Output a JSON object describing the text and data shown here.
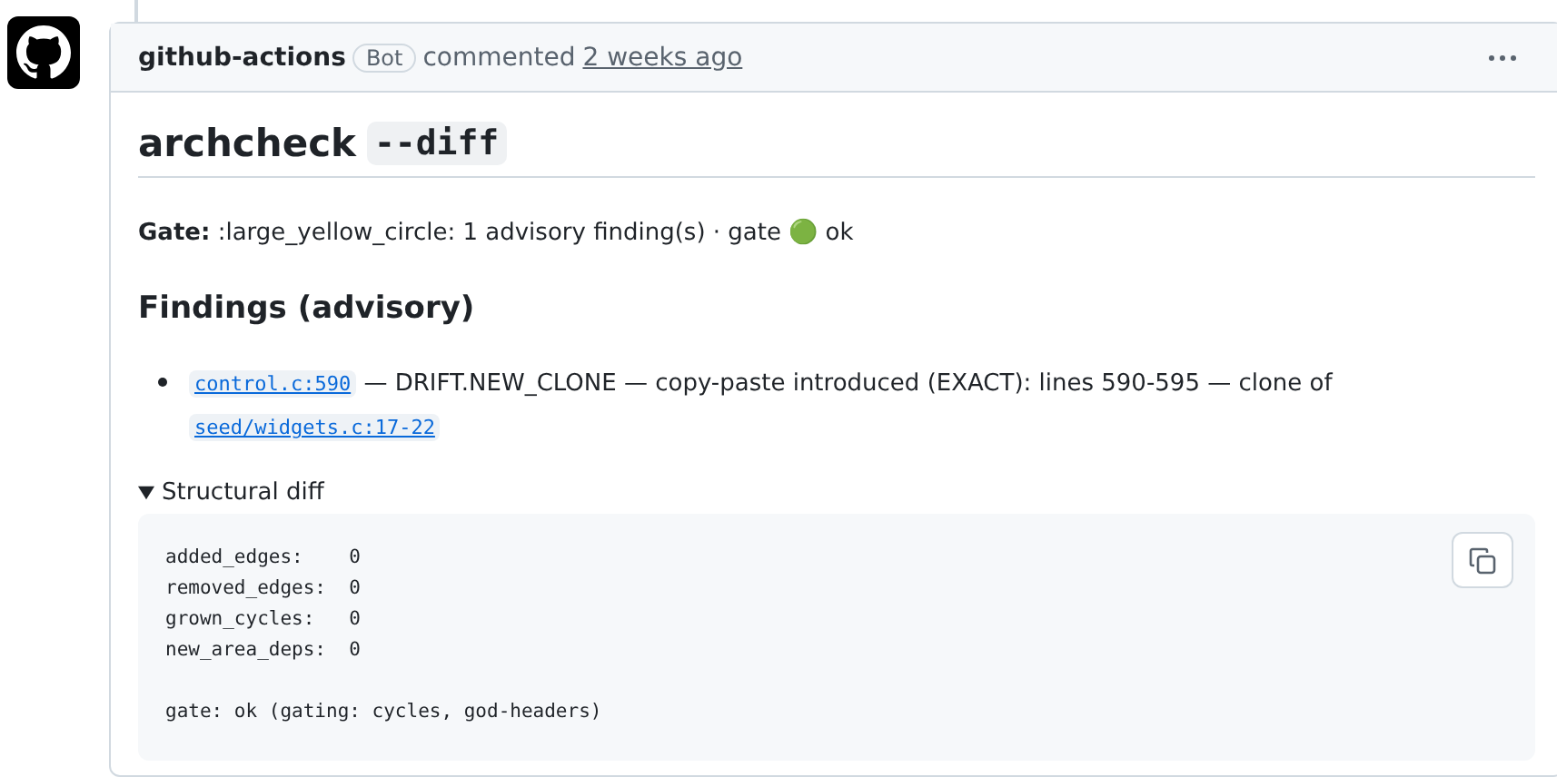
{
  "comment": {
    "author": "github-actions",
    "badge": "Bot",
    "action": "commented",
    "time": "2 weeks ago",
    "title": {
      "text": "archcheck",
      "code": "--diff"
    },
    "gate": {
      "label": "Gate:",
      "text": ":large_yellow_circle: 1 advisory finding(s) · gate 🟢 ok"
    },
    "findings": {
      "heading": "Findings (advisory)",
      "items": [
        {
          "link": "control.c:590",
          "text": "— DRIFT.NEW_CLONE — copy-paste introduced (EXACT): lines 590-595 — clone of",
          "link2": "seed/widgets.c:17-22"
        }
      ]
    },
    "details": {
      "summary": "Structural diff",
      "expanded": true,
      "code": "added_edges:    0\nremoved_edges:  0\ngrown_cycles:   0\nnew_area_deps:  0\n\ngate: ok (gating: cycles, god-headers)"
    }
  }
}
